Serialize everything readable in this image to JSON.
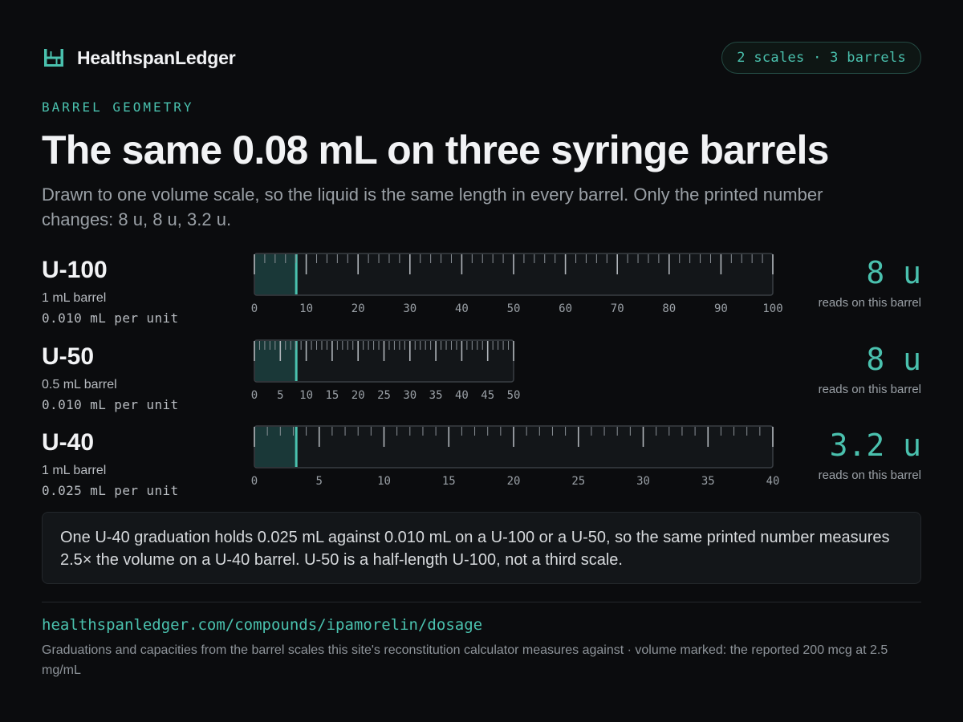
{
  "brand": {
    "name": "HealthspanLedger",
    "icon": "ledger-logo-icon"
  },
  "badge": "2 scales · 3 barrels",
  "eyebrow": "BARREL GEOMETRY",
  "title": "The same 0.08 mL on three syringe barrels",
  "subtitle": "Drawn to one volume scale, so the liquid is the same length in every barrel. Only the printed number changes: 8 u, 8 u, 3.2 u.",
  "colors": {
    "accent": "#4ac1ae",
    "fill": "#1a3838",
    "barrel_bg": "#131619",
    "barrel_border": "#3a3f44",
    "tick": "#8a9096",
    "tick_label": "#9aa0a6"
  },
  "chart_data": {
    "type": "diagram",
    "volume_marked_ml": 0.08,
    "barrels": [
      {
        "name": "U-100",
        "capacity_label": "1 mL barrel",
        "per_unit_label": "0.010 mL per unit",
        "max_units": 100,
        "tick_labels": [
          "0",
          "10",
          "20",
          "30",
          "40",
          "50",
          "60",
          "70",
          "80",
          "90",
          "100"
        ],
        "reading_value": 8,
        "reading_label": "8 u",
        "reading_caption": "reads on this barrel"
      },
      {
        "name": "U-50",
        "capacity_label": "0.5 mL barrel",
        "per_unit_label": "0.010 mL per unit",
        "max_units": 50,
        "tick_labels": [
          "0",
          "5",
          "10",
          "15",
          "20",
          "25",
          "30",
          "35",
          "40",
          "45",
          "50"
        ],
        "reading_value": 8,
        "reading_label": "8 u",
        "reading_caption": "reads on this barrel"
      },
      {
        "name": "U-40",
        "capacity_label": "1 mL barrel",
        "per_unit_label": "0.025 mL per unit",
        "max_units": 40,
        "tick_labels": [
          "0",
          "5",
          "10",
          "15",
          "20",
          "25",
          "30",
          "35",
          "40"
        ],
        "reading_value": 3.2,
        "reading_label": "3.2 u",
        "reading_caption": "reads on this barrel"
      }
    ]
  },
  "note": "One U-40 graduation holds 0.025 mL against 0.010 mL on a U-100 or a U-50, so the same printed number measures 2.5× the volume on a U-40 barrel. U-50 is a half-length U-100, not a third scale.",
  "footer": {
    "url": "healthspanledger.com/compounds/ipamorelin/dosage",
    "footnote": "Graduations and capacities from the barrel scales this site's reconstitution calculator measures against · volume marked: the reported 200 mcg at 2.5 mg/mL"
  }
}
